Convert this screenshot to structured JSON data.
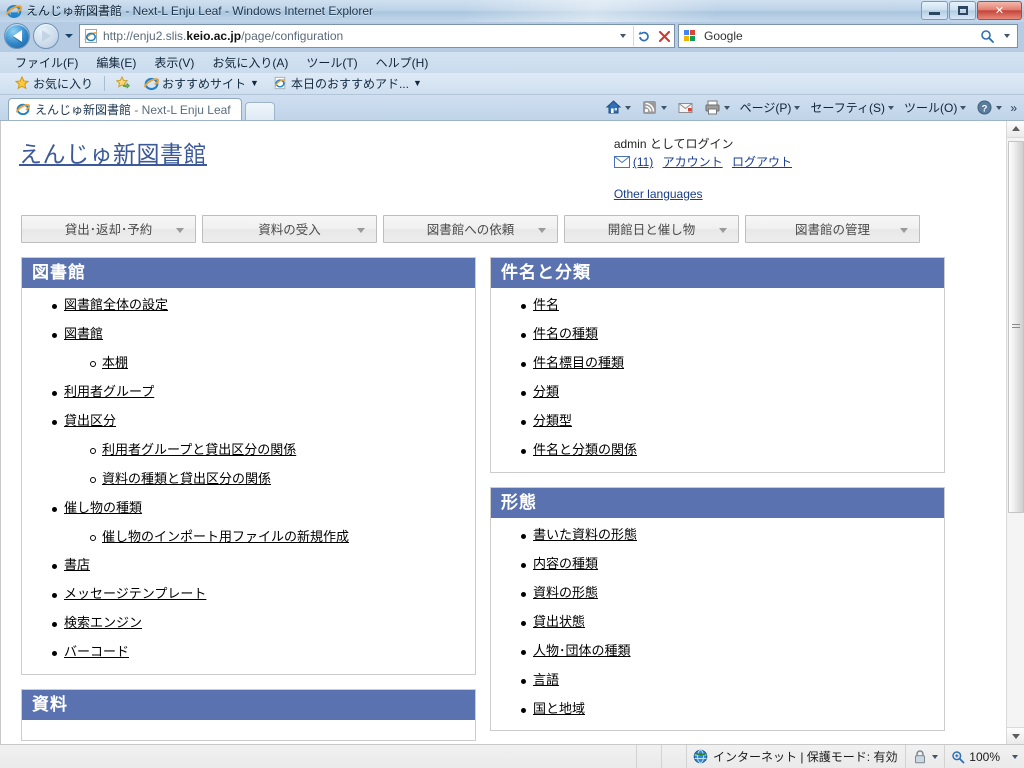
{
  "window": {
    "title_main": "えんじゅ新図書館",
    "title_rest": " - Next-L Enju Leaf - Windows Internet Explorer",
    "minimize_label": "最小化",
    "maximize_label": "最大化",
    "close_label": "✕"
  },
  "address": {
    "url_pre": "http://enju2.slis.",
    "url_domain": "keio.ac.jp",
    "url_post": "/page/configuration",
    "refresh_label": "↻",
    "stop_label": "✕",
    "dropdown_label": "▼"
  },
  "search": {
    "provider": "Google",
    "placeholder": "Google"
  },
  "menubar": {
    "items": [
      {
        "label": "ファイル(F)"
      },
      {
        "label": "編集(E)"
      },
      {
        "label": "表示(V)"
      },
      {
        "label": "お気に入り(A)"
      },
      {
        "label": "ツール(T)"
      },
      {
        "label": "ヘルプ(H)"
      }
    ]
  },
  "favorites_bar": {
    "favorites_label": "お気に入り",
    "items": [
      {
        "label": "おすすめサイト",
        "icon": "ie-icon",
        "caret": "▼"
      },
      {
        "label": "本日のおすすめアド...",
        "icon": "ie-icon",
        "caret": "▼"
      }
    ]
  },
  "tabs": [
    {
      "label_main": "えんじゅ新図書館",
      "label_rest": " - Next-L Enju Leaf",
      "active": true
    }
  ],
  "command_bar": {
    "items": [
      {
        "name": "home",
        "label": "",
        "caret": "▼"
      },
      {
        "name": "feeds",
        "label": "",
        "caret": "▼"
      },
      {
        "name": "read-mail",
        "label": "",
        "caret": ""
      },
      {
        "name": "print",
        "label": "",
        "caret": "▼"
      },
      {
        "name": "page",
        "label": "ページ(P)",
        "caret": "▼"
      },
      {
        "name": "safety",
        "label": "セーフティ(S)",
        "caret": "▼"
      },
      {
        "name": "tools",
        "label": "ツール(O)",
        "caret": "▼"
      },
      {
        "name": "help",
        "label": "",
        "caret": "▼"
      }
    ],
    "overflow": "»"
  },
  "page": {
    "site_title": "えんじゅ新図書館",
    "account": {
      "logged_in_as": "admin としてログイン",
      "message_count": "(11)",
      "account_link": "アカウント",
      "logout_link": "ログアウト",
      "other_languages": "Other languages"
    },
    "nav_buttons": [
      {
        "label": "貸出･返却･予約"
      },
      {
        "label": "資料の受入"
      },
      {
        "label": "図書館への依頼"
      },
      {
        "label": "開館日と催し物"
      },
      {
        "label": "図書館の管理"
      }
    ],
    "panels_left": [
      {
        "title": "図書館",
        "items": [
          {
            "label": "図書館全体の設定",
            "children": []
          },
          {
            "label": "図書館",
            "children": [
              {
                "label": "本棚"
              }
            ]
          },
          {
            "label": "利用者グループ",
            "children": []
          },
          {
            "label": "貸出区分",
            "children": [
              {
                "label": "利用者グループと貸出区分の関係"
              },
              {
                "label": "資料の種類と貸出区分の関係"
              }
            ]
          },
          {
            "label": "催し物の種類",
            "children": [
              {
                "label": "催し物のインポート用ファイルの新規作成"
              }
            ]
          },
          {
            "label": "書店",
            "children": []
          },
          {
            "label": "メッセージテンプレート",
            "children": []
          },
          {
            "label": "検索エンジン",
            "children": []
          },
          {
            "label": "バーコード",
            "children": []
          }
        ]
      },
      {
        "title": "資料",
        "items": []
      }
    ],
    "panels_right": [
      {
        "title": "件名と分類",
        "items": [
          {
            "label": "件名",
            "children": []
          },
          {
            "label": "件名の種類",
            "children": []
          },
          {
            "label": "件名標目の種類",
            "children": []
          },
          {
            "label": "分類",
            "children": []
          },
          {
            "label": "分類型",
            "children": []
          },
          {
            "label": "件名と分類の関係",
            "children": []
          }
        ]
      },
      {
        "title": "形態",
        "items": [
          {
            "label": "書いた資料の形態",
            "children": []
          },
          {
            "label": "内容の種類",
            "children": []
          },
          {
            "label": "資料の形態",
            "children": []
          },
          {
            "label": "貸出状態",
            "children": []
          },
          {
            "label": "人物･団体の種類",
            "children": []
          },
          {
            "label": "言語",
            "children": []
          },
          {
            "label": "国と地域",
            "children": []
          }
        ]
      }
    ]
  },
  "statusbar": {
    "zone": "インターネット | 保護モード: 有効",
    "zoom": "100%",
    "zoom_caret": "▼",
    "lock_caret": "▼"
  },
  "colors": {
    "panel_header_bg": "#5a73b0",
    "site_title": "#3b5998",
    "link": "#000000",
    "account_link": "#1a3c8c"
  }
}
